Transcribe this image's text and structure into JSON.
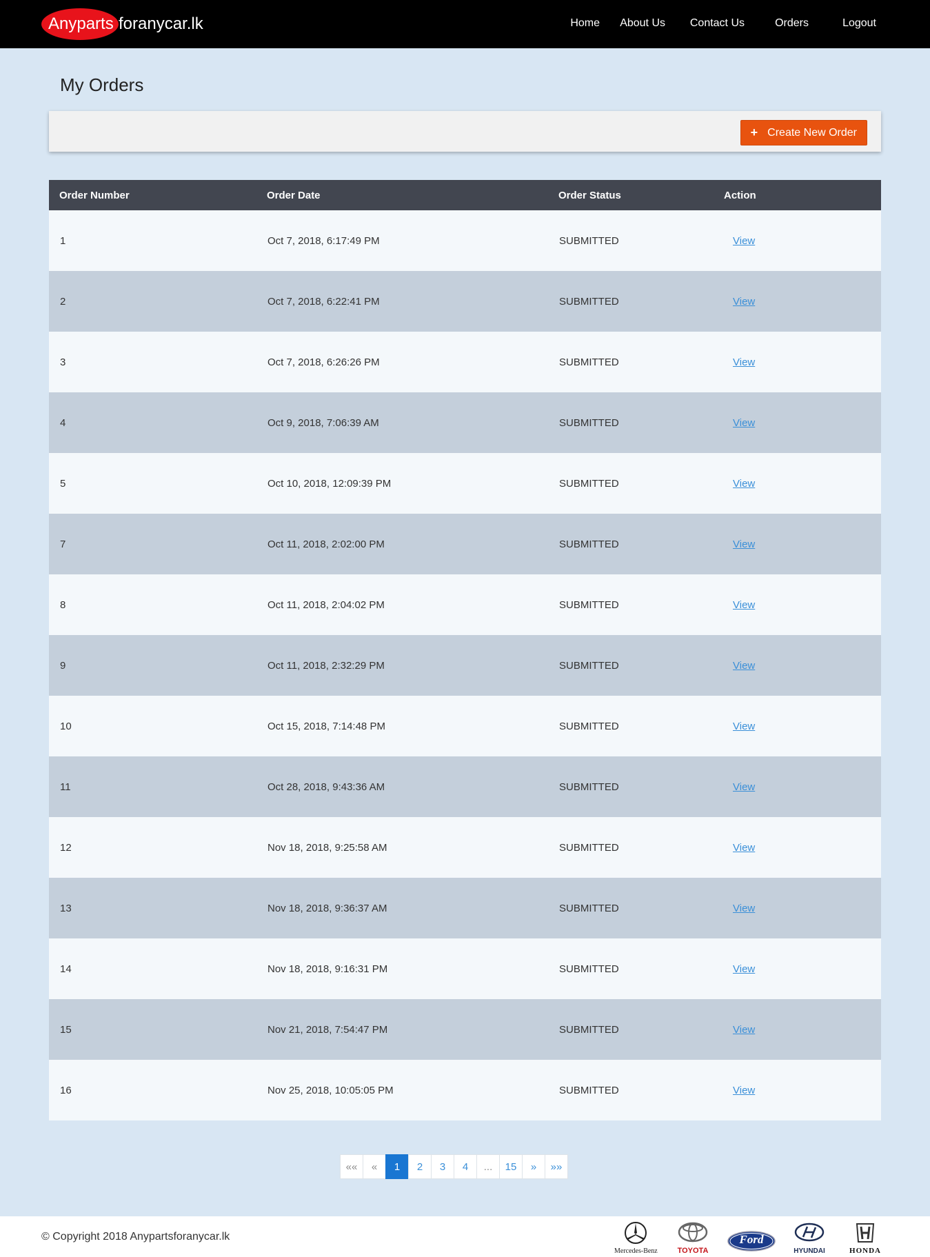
{
  "brand": {
    "part1": "Anyparts",
    "part2": "foranycar.lk"
  },
  "nav": {
    "items": [
      {
        "label": "Home"
      },
      {
        "label": "About Us"
      },
      {
        "label": "Contact Us"
      },
      {
        "label": "Orders"
      },
      {
        "label": "Logout"
      }
    ]
  },
  "page": {
    "title": "My Orders"
  },
  "toolbar": {
    "create_label": "Create New Order",
    "create_icon": "+"
  },
  "table": {
    "headers": [
      "Order Number",
      "Order Date",
      "Order Status",
      "Action"
    ],
    "rows": [
      {
        "number": "1",
        "date": "Oct 7, 2018, 6:17:49 PM",
        "status": "SUBMITTED",
        "action": "View"
      },
      {
        "number": "2",
        "date": "Oct 7, 2018, 6:22:41 PM",
        "status": "SUBMITTED",
        "action": "View"
      },
      {
        "number": "3",
        "date": "Oct 7, 2018, 6:26:26 PM",
        "status": "SUBMITTED",
        "action": "View"
      },
      {
        "number": "4",
        "date": "Oct 9, 2018, 7:06:39 AM",
        "status": "SUBMITTED",
        "action": "View"
      },
      {
        "number": "5",
        "date": "Oct 10, 2018, 12:09:39 PM",
        "status": "SUBMITTED",
        "action": "View"
      },
      {
        "number": "7",
        "date": "Oct 11, 2018, 2:02:00 PM",
        "status": "SUBMITTED",
        "action": "View"
      },
      {
        "number": "8",
        "date": "Oct 11, 2018, 2:04:02 PM",
        "status": "SUBMITTED",
        "action": "View"
      },
      {
        "number": "9",
        "date": "Oct 11, 2018, 2:32:29 PM",
        "status": "SUBMITTED",
        "action": "View"
      },
      {
        "number": "10",
        "date": "Oct 15, 2018, 7:14:48 PM",
        "status": "SUBMITTED",
        "action": "View"
      },
      {
        "number": "11",
        "date": "Oct 28, 2018, 9:43:36 AM",
        "status": "SUBMITTED",
        "action": "View"
      },
      {
        "number": "12",
        "date": "Nov 18, 2018, 9:25:58 AM",
        "status": "SUBMITTED",
        "action": "View"
      },
      {
        "number": "13",
        "date": "Nov 18, 2018, 9:36:37 AM",
        "status": "SUBMITTED",
        "action": "View"
      },
      {
        "number": "14",
        "date": "Nov 18, 2018, 9:16:31 PM",
        "status": "SUBMITTED",
        "action": "View"
      },
      {
        "number": "15",
        "date": "Nov 21, 2018, 7:54:47 PM",
        "status": "SUBMITTED",
        "action": "View"
      },
      {
        "number": "16",
        "date": "Nov 25, 2018, 10:05:05 PM",
        "status": "SUBMITTED",
        "action": "View"
      }
    ]
  },
  "pagination": {
    "current_page": "1",
    "items": [
      {
        "label": "««",
        "kind": "first"
      },
      {
        "label": "«",
        "kind": "prev"
      },
      {
        "label": "1",
        "kind": "page"
      },
      {
        "label": "2",
        "kind": "page"
      },
      {
        "label": "3",
        "kind": "page"
      },
      {
        "label": "4",
        "kind": "page"
      },
      {
        "label": "...",
        "kind": "ellipsis"
      },
      {
        "label": "15",
        "kind": "page"
      },
      {
        "label": "»",
        "kind": "next"
      },
      {
        "label": "»»",
        "kind": "last"
      }
    ]
  },
  "footer": {
    "copyright": "© Copyright 2018 Anypartsforanycar.lk",
    "brands": [
      {
        "name": "Mercedes-Benz",
        "icon": "mercedes-star-icon"
      },
      {
        "name": "TOYOTA",
        "icon": "toyota-ellipses-icon"
      },
      {
        "name": "Ford",
        "icon": "ford-oval-icon"
      },
      {
        "name": "HYUNDAI",
        "icon": "hyundai-h-icon"
      },
      {
        "name": "HONDA",
        "icon": "honda-h-icon"
      }
    ]
  },
  "colors": {
    "navbar_bg": "#000000",
    "brand_red": "#e8131b",
    "page_bg": "#d8e6f3",
    "header_bg": "#424650",
    "row_light": "#f4f8fb",
    "row_dark": "#c4cfdb",
    "accent_orange": "#e8530f",
    "link_blue": "#3a8fd8",
    "active_page_blue": "#1976d2"
  }
}
